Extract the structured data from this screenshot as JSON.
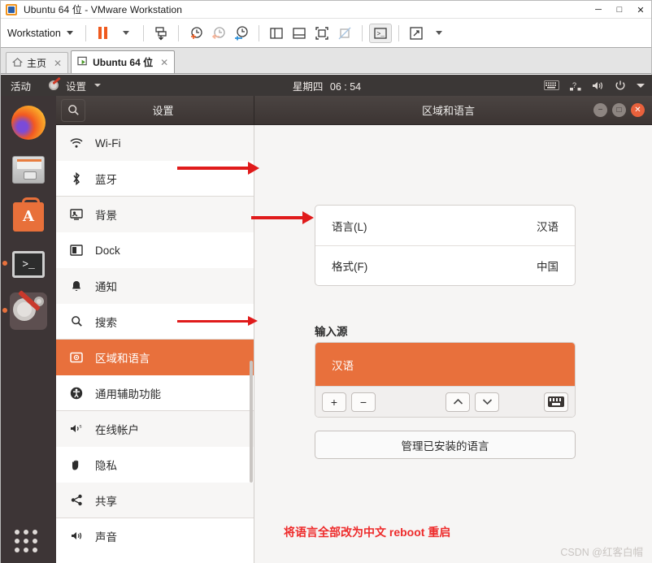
{
  "vmware": {
    "title": "Ubuntu 64 位 - VMware Workstation",
    "menu_label": "Workstation",
    "window_controls": {
      "minimize": "─",
      "maximize": "□",
      "close": "✕"
    },
    "toolbar_icons": [
      "pause-icon",
      "pause-dropdown-icon",
      "send-ctrl-alt-del-icon",
      "take-snapshot-icon",
      "revert-snapshot-icon",
      "snapshot-manager-icon",
      "show-two-panes-icon",
      "show-console-icon",
      "fit-guest-icon",
      "fit-window-disabled-icon",
      "unity-mode-icon",
      "fullscreen-icon",
      "fullscreen-dropdown-icon"
    ],
    "tabs": [
      {
        "label": "主页",
        "icon": "home-icon",
        "active": false,
        "close": "✕"
      },
      {
        "label": "Ubuntu 64 位",
        "icon": "vm-play-icon",
        "active": true,
        "close": "✕"
      }
    ]
  },
  "ubuntu_topbar": {
    "activities": "活动",
    "app_menu": "设置",
    "app_icon": "settings-gear-wrench-icon",
    "weekday": "星期四",
    "time": "06 : 54",
    "tray": [
      "keyboard-icon",
      "network-icon",
      "volume-icon",
      "power-icon",
      "chevron-down-icon"
    ]
  },
  "dock": {
    "items": [
      {
        "name": "firefox",
        "icon": "firefox-icon",
        "running": false,
        "active": false
      },
      {
        "name": "files",
        "icon": "files-icon",
        "running": false,
        "active": false
      },
      {
        "name": "software",
        "icon": "ubuntu-software-icon",
        "label": "A",
        "running": false,
        "active": false
      },
      {
        "name": "terminal",
        "icon": "terminal-icon",
        "label": ">_",
        "running": true,
        "active": false
      },
      {
        "name": "settings",
        "icon": "settings-icon",
        "running": true,
        "active": true
      }
    ],
    "show_apps": "show-applications-icon"
  },
  "settings_window": {
    "search_icon": "search-icon",
    "sidebar_title": "设置",
    "page_title": "区域和语言",
    "window_controls": {
      "minimize": "−",
      "maximize": "□",
      "close": "✕"
    },
    "sidebar_items": [
      {
        "label": "Wi-Fi",
        "icon": "wifi-icon",
        "selected": false
      },
      {
        "label": "蓝牙",
        "icon": "bluetooth-icon",
        "selected": false
      },
      {
        "label": "背景",
        "icon": "background-icon",
        "selected": false
      },
      {
        "label": "Dock",
        "icon": "dock-icon",
        "selected": false
      },
      {
        "label": "通知",
        "icon": "bell-icon",
        "selected": false
      },
      {
        "label": "搜索",
        "icon": "search-icon",
        "selected": false
      },
      {
        "label": "区域和语言",
        "icon": "region-language-icon",
        "selected": true
      },
      {
        "label": "通用辅助功能",
        "icon": "accessibility-icon",
        "selected": false
      },
      {
        "label": "在线帐户",
        "icon": "online-accounts-icon",
        "selected": false
      },
      {
        "label": "隐私",
        "icon": "privacy-hand-icon",
        "selected": false
      },
      {
        "label": "共享",
        "icon": "sharing-icon",
        "selected": false
      },
      {
        "label": "声音",
        "icon": "sound-icon",
        "selected": false
      }
    ],
    "language_card": [
      {
        "label": "语言(L)",
        "value": "汉语"
      },
      {
        "label": "格式(F)",
        "value": "中国"
      }
    ],
    "input_sources": {
      "title": "输入源",
      "items": [
        "汉语"
      ],
      "add_button": "+",
      "remove_button": "−",
      "move_up_button": "⌃",
      "move_down_button": "⌄",
      "keyboard_preview_button": "keyboard-icon"
    },
    "manage_languages_button": "管理已安装的语言"
  },
  "annotations": {
    "note": "将语言全部改为中文  reboot  重启",
    "arrow_count": 3
  },
  "watermark": "CSDN @红客白帽",
  "colors": {
    "ubuntu_orange": "#e8703c",
    "rail_orange": "#ef8b5f",
    "annotation_red": "#e01b1b",
    "topbar_dark": "#3b3736",
    "dock_dark": "#3d3536"
  }
}
